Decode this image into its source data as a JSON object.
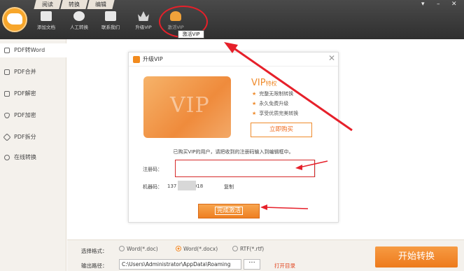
{
  "menu_tabs": [
    "阅读",
    "转换",
    "编辑"
  ],
  "toolbar": {
    "buttons": [
      {
        "label": "添加文档",
        "icon": "folder-plus-icon"
      },
      {
        "label": "人工转换",
        "icon": "headset-icon"
      },
      {
        "label": "联系我们",
        "icon": "chat-icon"
      },
      {
        "label": "升级VIP",
        "icon": "crown-icon"
      },
      {
        "label": "激活VIP",
        "icon": "user-key-icon"
      }
    ],
    "tooltip": "激活VIP"
  },
  "window_controls": {
    "menu": "▾",
    "minimize": "–",
    "close": "✕"
  },
  "sidebar": {
    "items": [
      {
        "label": "PDF转Word",
        "icon": "word-icon",
        "active": true
      },
      {
        "label": "PDF合并",
        "icon": "merge-icon"
      },
      {
        "label": "PDF解密",
        "icon": "unlock-icon"
      },
      {
        "label": "PDF加密",
        "icon": "shield-icon"
      },
      {
        "label": "PDF拆分",
        "icon": "split-icon"
      },
      {
        "label": "在线转换",
        "icon": "cloud-icon"
      }
    ]
  },
  "dialog": {
    "title": "升级VIP",
    "close": "✕",
    "card_text": "VIP",
    "vip_heading": "VIP",
    "vip_heading_small": "特权",
    "perks": [
      "完整无限制转换",
      "永久免费升级",
      "享受优质完美转换"
    ],
    "buy_label": "立即购买",
    "notice": "已购买VIP的用户，请把收到的注册码输入到编辑框中。",
    "reg_label": "注册码：",
    "reg_value": "",
    "machine_label": "机器码：",
    "machine_value": "137          01696018",
    "copy_label": "复制",
    "activate_label": "完成激活"
  },
  "bottom": {
    "format_label": "选择格式：",
    "formats": [
      "Word(*.doc)",
      "Word(*.docx)",
      "RTF(*.rtf)"
    ],
    "selected_format": "Word(*.docx)",
    "path_label": "输出路径：",
    "path_value": "C:\\Users\\Administrator\\AppData\\Roaming",
    "browse_label": "···",
    "open_dir_label": "打开目录",
    "start_label": "开始转换"
  },
  "colors": {
    "accent": "#ef8b2c",
    "annotation": "#e6202a",
    "topbar": "#383838"
  }
}
